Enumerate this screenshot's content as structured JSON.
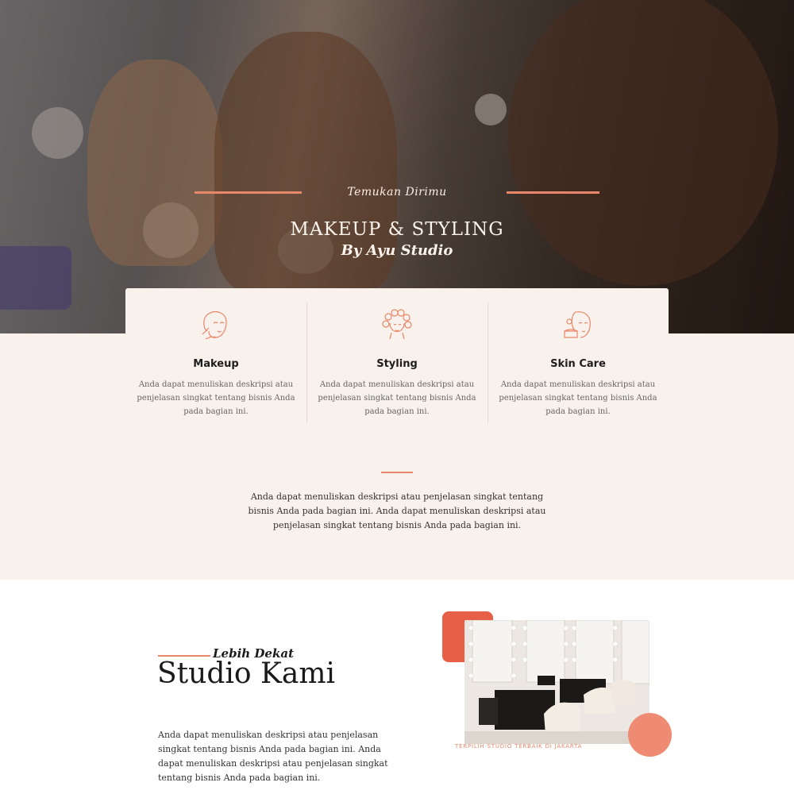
{
  "hero": {
    "tagline": "Temukan Dirimu",
    "title": "MAKEUP & STYLING",
    "subtitle": "By Ayu Studio"
  },
  "services": [
    {
      "title": "Makeup",
      "icon": "face-makeup-icon",
      "description": "Anda dapat menuliskan deskripsi atau penjelasan singkat tentang bisnis Anda pada bagian ini."
    },
    {
      "title": "Styling",
      "icon": "hair-curlers-icon",
      "description": "Anda dapat menuliskan deskripsi atau penjelasan singkat tentang bisnis Anda pada bagian ini."
    },
    {
      "title": "Skin Care",
      "icon": "skincare-cream-icon",
      "description": "Anda dapat menuliskan deskripsi atau penjelasan singkat tentang bisnis Anda pada bagian ini."
    }
  ],
  "intro": {
    "text": "Anda dapat menuliskan deskripsi atau penjelasan singkat tentang bisnis Anda pada bagian ini. Anda dapat menuliskan deskripsi atau penjelasan singkat tentang bisnis Anda pada bagian ini."
  },
  "about": {
    "script_heading": "Lebih Dekat",
    "title": "Studio Kami",
    "text": "Anda dapat menuliskan deskripsi atau penjelasan singkat tentang bisnis Anda pada bagian ini. Anda dapat menuliskan deskripsi atau penjelasan singkat tentang bisnis Anda pada bagian ini.",
    "photo_caption": "TERPILIH STUDIO TERBAIK DI JAKARTA"
  },
  "colors": {
    "accent": "#e8876a",
    "accent_dark": "#e85f47",
    "cream": "#f9f1ec"
  }
}
